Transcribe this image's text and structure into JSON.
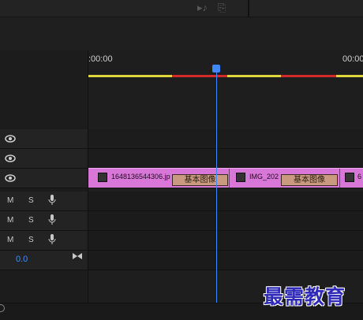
{
  "ruler": {
    "timecode_left": ":00:00",
    "timecode_right": "00:00"
  },
  "clips": [
    {
      "name": "1648136544306.jp",
      "effect": "基本图像"
    },
    {
      "name": "IMG_202",
      "effect": "基本图像"
    },
    {
      "name": "6"
    }
  ],
  "audio_tracks": [
    {
      "mute": "M",
      "solo": "S"
    },
    {
      "mute": "M",
      "solo": "S"
    },
    {
      "mute": "M",
      "solo": "S"
    }
  ],
  "master": {
    "volume": "0.0"
  },
  "watermark": "最需教育",
  "colors": {
    "clip": "#d977d9",
    "playhead": "#3f86ff",
    "workarea_yellow": "#e0d83a",
    "workarea_red": "#d42a2a"
  }
}
